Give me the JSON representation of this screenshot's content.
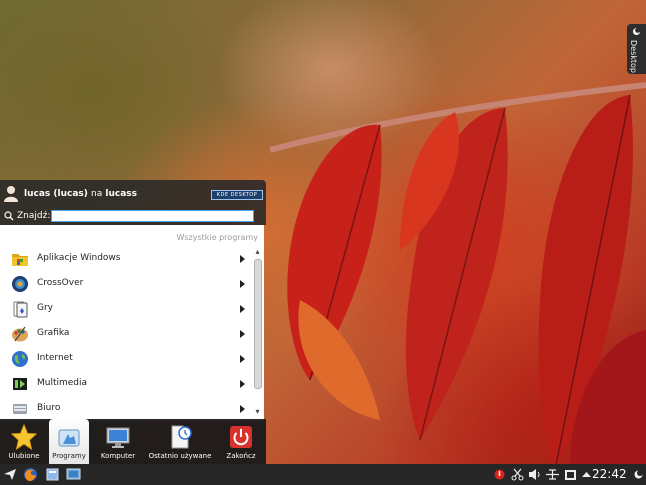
{
  "desktop_tab": {
    "label": "Desktop"
  },
  "launcher": {
    "user_name": "lucas (lucas)",
    "user_on": "na",
    "host": "lucass",
    "logo_text": "KDE DESKTOP",
    "search": {
      "label": "Znajdź:",
      "value": "",
      "placeholder": ""
    },
    "all_programs_label": "Wszystkie programy",
    "items": [
      {
        "label": "Aplikacje Windows",
        "icon": "folder-icon"
      },
      {
        "label": "CrossOver",
        "icon": "crossover-icon"
      },
      {
        "label": "Gry",
        "icon": "games-icon"
      },
      {
        "label": "Grafika",
        "icon": "graphics-icon"
      },
      {
        "label": "Internet",
        "icon": "internet-icon"
      },
      {
        "label": "Multimedia",
        "icon": "multimedia-icon"
      },
      {
        "label": "Biuro",
        "icon": "office-icon"
      }
    ],
    "tabs": [
      {
        "label": "Ulubione",
        "icon": "star-icon"
      },
      {
        "label": "Programy",
        "icon": "applications-icon",
        "active": true
      },
      {
        "label": "Komputer",
        "icon": "computer-icon"
      },
      {
        "label": "Ostatnio używane",
        "icon": "recent-icon"
      },
      {
        "label": "Zakończ",
        "icon": "power-icon"
      }
    ]
  },
  "taskbar": {
    "clock": "22:42",
    "tray_icons": [
      "notification-icon",
      "cut-icon",
      "volume-icon",
      "network-icon",
      "battery-icon",
      "expand-icon"
    ],
    "launchers": [
      "kickoff-icon",
      "firefox-icon",
      "file-manager-icon",
      "desktop-icon"
    ]
  }
}
